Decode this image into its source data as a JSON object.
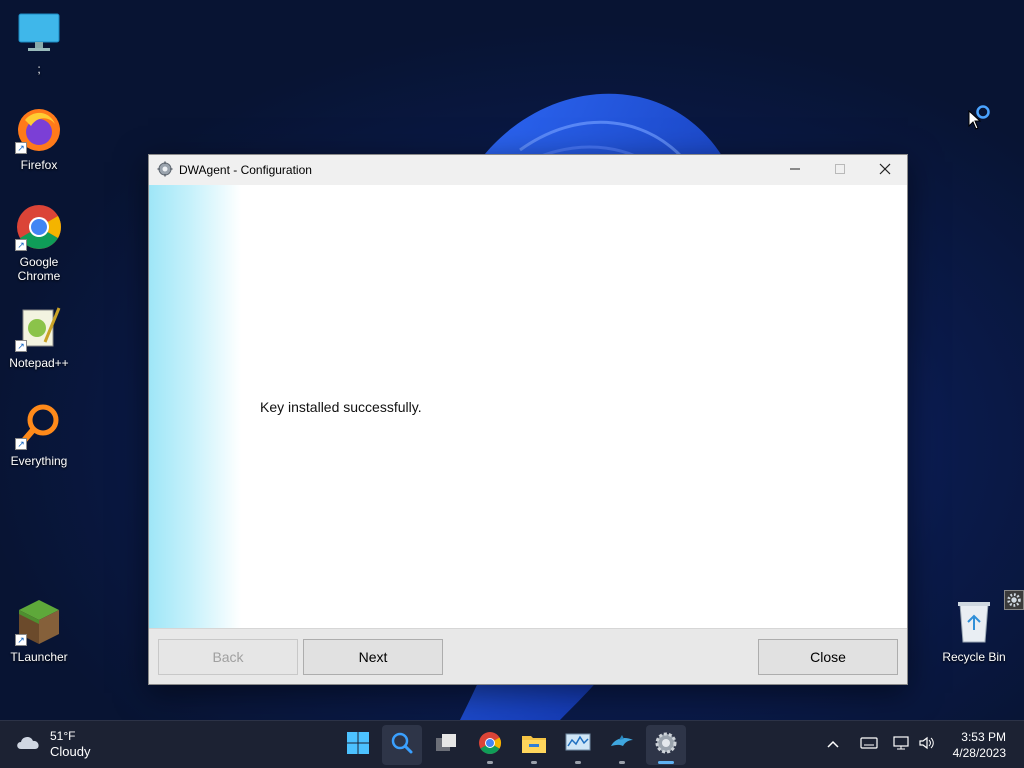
{
  "desktop": {
    "icons": [
      {
        "label": ";"
      },
      {
        "label": "Firefox"
      },
      {
        "label": "Google Chrome"
      },
      {
        "label": "Notepad++"
      },
      {
        "label": "Everything"
      },
      {
        "label": "TLauncher"
      },
      {
        "label": "Recycle Bin"
      }
    ]
  },
  "window": {
    "title": "DWAgent - Configuration",
    "message": "Key installed successfully.",
    "buttons": {
      "back": "Back",
      "next": "Next",
      "close": "Close"
    },
    "back_enabled": false
  },
  "taskbar": {
    "weather": {
      "temperature": "51°F",
      "condition": "Cloudy"
    },
    "apps": [
      "start-menu",
      "search",
      "task-view",
      "google-chrome",
      "file-explorer",
      "resource-monitor",
      "dolphin-app",
      "dwagent-settings"
    ],
    "active_app": "dwagent-settings",
    "clock": {
      "time": "3:53 PM",
      "date": "4/28/2023"
    }
  },
  "colors": {
    "taskbar": "#1c2233",
    "window_side_band": "#9fe6f7",
    "accent": "#5fb2f2"
  }
}
